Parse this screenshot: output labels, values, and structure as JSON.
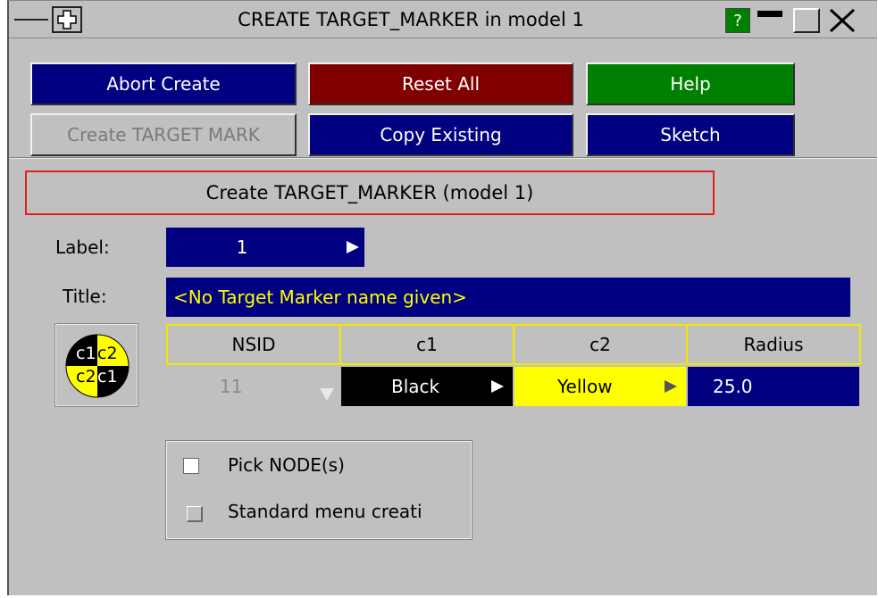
{
  "window": {
    "title": "CREATE TARGET_MARKER in model 1",
    "help_glyph": "?",
    "move_icon": "move-icon",
    "minimize_icon": "minimize-icon",
    "maximize_icon": "maximize-icon",
    "close_icon": "close-icon",
    "menu_icon": "window-menu-icon"
  },
  "buttons": {
    "abort": "Abort Create",
    "reset": "Reset All",
    "help": "Help",
    "create": "Create TARGET MARK",
    "copy": "Copy Existing",
    "sketch": "Sketch"
  },
  "heading": "Create TARGET_MARKER (model 1)",
  "label": {
    "caption": "Label:",
    "value": "1"
  },
  "title": {
    "caption": "Title:",
    "value": "<No Target Marker name given>"
  },
  "marker_icon": {
    "tl": "c1",
    "tr": "c2",
    "bl": "c2",
    "br": "c1"
  },
  "table": {
    "headers": [
      "NSID",
      "c1",
      "c2",
      "Radius"
    ],
    "row": {
      "nsid": "11",
      "c1": "Black",
      "c2": "Yellow",
      "radius": "25.0"
    }
  },
  "options": {
    "pick_nodes": "Pick NODE(s)",
    "standard_menu": "Standard menu creati"
  },
  "colors": {
    "panel": "#c0c0c0",
    "navy": "#000080",
    "maroon": "#800000",
    "green": "#008000",
    "yellow": "#ffff00",
    "heading_border": "#e02020"
  }
}
